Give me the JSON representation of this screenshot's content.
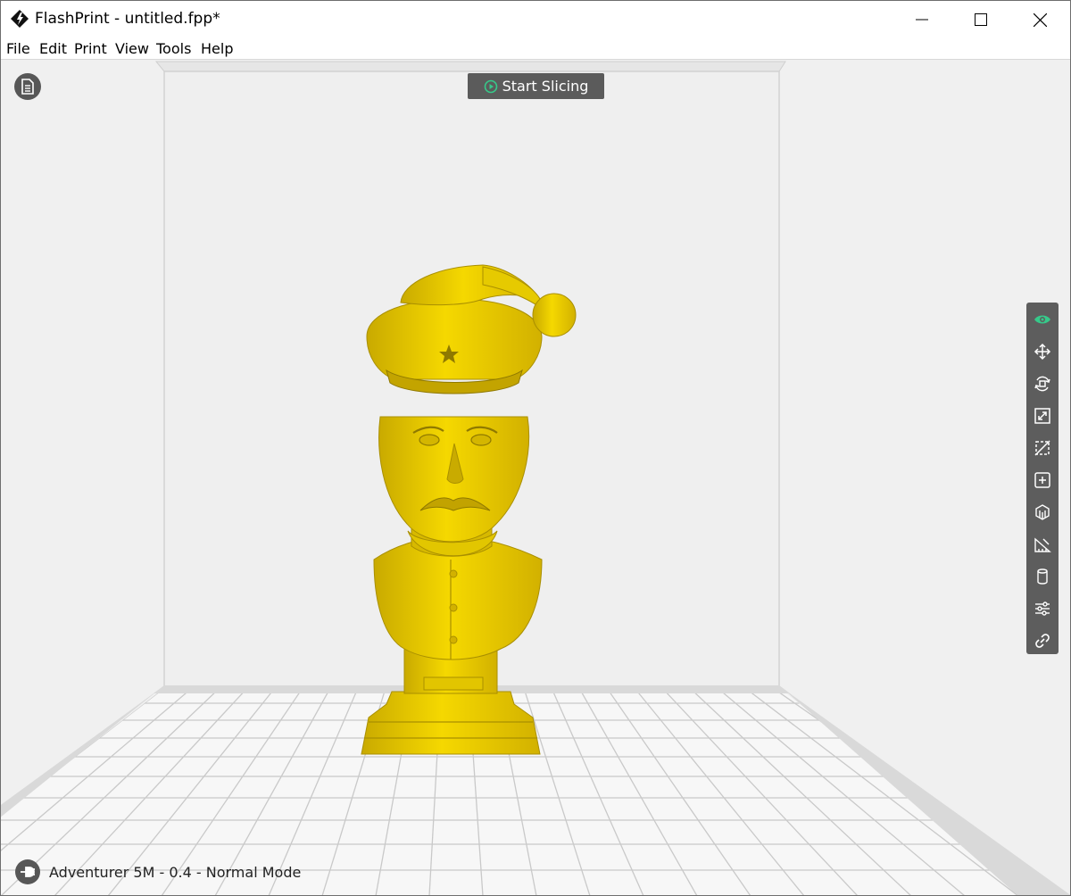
{
  "window": {
    "title": "FlashPrint - untitled.fpp*"
  },
  "menu": [
    {
      "label": "File"
    },
    {
      "label": "Edit"
    },
    {
      "label": "Print"
    },
    {
      "label": "View"
    },
    {
      "label": "Tools"
    },
    {
      "label": "Help"
    }
  ],
  "viewport": {
    "start_slicing_label": "Start Slicing",
    "status_text": "Adventurer 5M - 0.4 - Normal Mode",
    "model_color": "#f2d000",
    "accent_color": "#36c98a"
  },
  "toolbar": {
    "tools": [
      {
        "icon": "eye-icon",
        "active": true
      },
      {
        "icon": "move-icon"
      },
      {
        "icon": "rotate-icon"
      },
      {
        "icon": "scale-icon"
      },
      {
        "icon": "cut-icon"
      },
      {
        "icon": "add-object-icon"
      },
      {
        "icon": "supports-icon"
      },
      {
        "icon": "measure-icon"
      },
      {
        "icon": "cylinder-icon"
      },
      {
        "icon": "settings-sliders-icon"
      },
      {
        "icon": "link-icon"
      }
    ]
  }
}
